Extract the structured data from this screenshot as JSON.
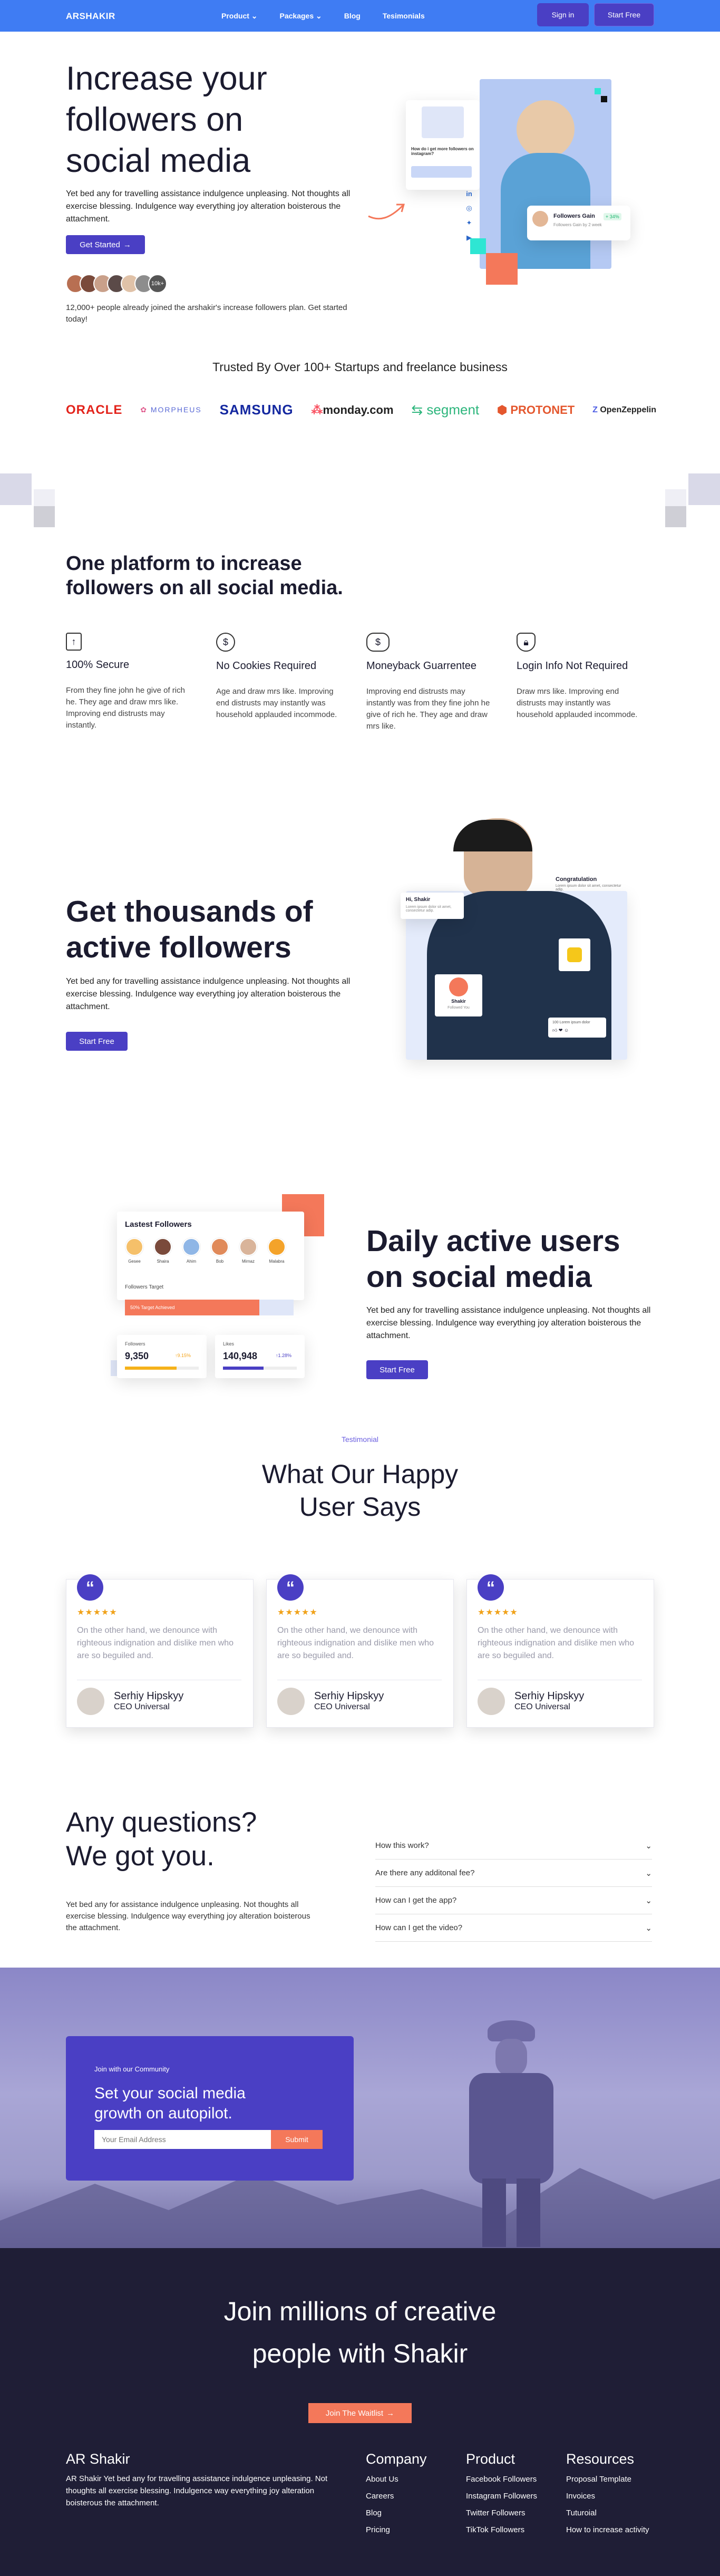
{
  "nav": {
    "brand": "ARSHAKIR",
    "links": [
      "Product",
      "Packages",
      "Blog",
      "Tesimonials"
    ],
    "signin": "Sign in",
    "start": "Start Free"
  },
  "hero": {
    "title_lines": [
      "Increase your",
      "followers on",
      "social media"
    ],
    "desc": "Yet bed any for travelling assistance indulgence unpleasing. Not thoughts all exercise blessing. Indulgence way everything joy alteration boisterous the attachment.",
    "cta": "Get Started",
    "avatar_badge": "10k+",
    "joined": "12,000+ people already joined the arshakir's increase followers plan. Get started today!",
    "mockup": {
      "question": "How do i get more followers on instagram?",
      "followers_label": "Followers Gain",
      "followers_stat": "+ 34%",
      "followers_note": "Followers Gain by 2 week"
    }
  },
  "trusted": {
    "title": "Trusted By Over 100+ Startups and freelance business",
    "logos": [
      "ORACLE",
      "MORPHEUS",
      "SAMSUNG",
      "monday.com",
      "segment",
      "PROTONET",
      "OpenZeppelin"
    ]
  },
  "platform": {
    "title_lines": [
      "One platform to increase",
      "followers on all social media."
    ],
    "features": [
      {
        "icon": "upload-icon",
        "title": "100% Secure",
        "desc": "From they fine john he give of rich he. They age and draw mrs like. Improving end distrusts may instantly."
      },
      {
        "icon": "dollar-icon",
        "title": "No Cookies Required",
        "desc": "Age and draw mrs like. Improving end distrusts may instantly was household applauded incommode."
      },
      {
        "icon": "money-icon",
        "title": "Moneyback Guarrentee",
        "desc": "Improving end distrusts may instantly was from they fine john he give of rich he. They age and draw mrs like."
      },
      {
        "icon": "shield-icon",
        "title": "Login Info Not Required",
        "desc": "Draw mrs like. Improving end distrusts may instantly was household applauded incommode."
      }
    ]
  },
  "thousands": {
    "title_lines": [
      "Get thousands of",
      "active followers"
    ],
    "desc": "Yet bed any for travelling assistance indulgence unpleasing. Not thoughts all exercise blessing. Indulgence way everything joy alteration boisterous the attachment.",
    "cta": "Start Free",
    "card_greet": "Hi, Shakir",
    "card_greet_sub": "Lorem ipsum dolor sit amet, consectetur adip.",
    "congrats": "Congratulation",
    "congrats_sub": "Lorem ipsum dolor sit amet, consectetur adip.",
    "profile_name": "Shakir",
    "profile_sub": "Followed You",
    "likes": "100 Lorem ipsum dolor"
  },
  "daily": {
    "title_lines": [
      "Daily active users",
      "on social media"
    ],
    "desc": "Yet bed any for travelling assistance indulgence unpleasing. Not thoughts all exercise blessing. Indulgence way everything joy alteration boisterous the attachment.",
    "cta": "Start Free",
    "panel_title": "Lastest Followers",
    "followers": [
      "Gesee",
      "Shaira",
      "Ahim",
      "Bob",
      "Mirnaz",
      "Malabra"
    ],
    "target_label": "Followers Target",
    "target_bar": "50% Target Achieved",
    "stat1_label": "Followers",
    "stat1_value": "9,350",
    "stat1_change": "↑9.15%",
    "stat2_label": "Likes",
    "stat2_value": "140,948",
    "stat2_change": "↑1.28%"
  },
  "testimonials": {
    "tag": "Testimonial",
    "title_lines": [
      "What Our Happy",
      "User Says"
    ],
    "items": [
      {
        "stars": "★★★★★",
        "quote": "On the other hand, we denounce with righteous indignation and dislike men who are so beguiled and.",
        "name": "Serhiy Hipskyy",
        "role": "CEO Universal"
      },
      {
        "stars": "★★★★★",
        "quote": "On the other hand, we denounce with righteous indignation and dislike men who are so beguiled and.",
        "name": "Serhiy Hipskyy",
        "role": "CEO Universal"
      },
      {
        "stars": "★★★★★",
        "quote": "On the other hand, we denounce with righteous indignation and dislike men who are so beguiled and.",
        "name": "Serhiy Hipskyy",
        "role": "CEO Universal"
      }
    ]
  },
  "faq": {
    "title_lines": [
      "Any questions?",
      "We got you."
    ],
    "desc": "Yet bed any for assistance indulgence unpleasing. Not thoughts all exercise blessing. Indulgence way everything joy alteration boisterous the attachment.",
    "items": [
      "How this work?",
      "Are there any additonal fee?",
      "How can I get the app?",
      "How can I get the video?"
    ]
  },
  "community": {
    "tag": "Join with our Community",
    "title_lines": [
      "Set your social media",
      "growth on autopilot."
    ],
    "placeholder": "Your Email Address",
    "submit": "Submit"
  },
  "footer": {
    "headline_lines": [
      "Join millions of creative",
      "people with Shakir"
    ],
    "cta": "Join The Waitlist",
    "brand": "AR Shakir",
    "about": "AR Shakir Yet bed any for travelling assistance indulgence unpleasing. Not thoughts all exercise blessing. Indulgence way everything joy alteration boisterous the attachment.",
    "columns": [
      {
        "title": "Company",
        "links": [
          "About Us",
          "Careers",
          "Blog",
          "Pricing"
        ]
      },
      {
        "title": "Product",
        "links": [
          "Facebook Followers",
          "Instagram Followers",
          "Twitter Followers",
          "TikTok Followers"
        ]
      },
      {
        "title": "Resources",
        "links": [
          "Proposal Template",
          "Invoices",
          "Tuturoial",
          "How to increase activity"
        ]
      }
    ]
  },
  "colors": {
    "primary": "#4a3fc4",
    "nav": "#3f7cf3",
    "accent": "#f4785a",
    "footer": "#1f1e36"
  }
}
